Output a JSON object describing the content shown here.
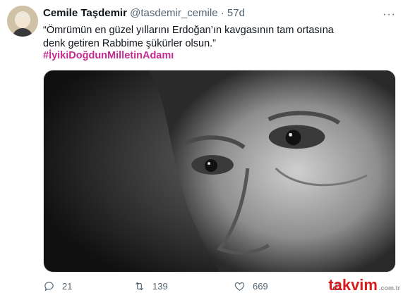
{
  "tweet": {
    "author_name": "Cemile Taşdemir",
    "handle": "@tasdemir_cemile",
    "separator": "·",
    "time": "57d",
    "text": "“Ömrümün en güzel yıllarını Erdoğan’ın kavgasının tam ortasına denk getiren Rabbime şükürler olsun.”",
    "hashtag": "#İyikiDoğdunMilletinAdamı",
    "more_label": "···",
    "media_icon": "portrait-photo"
  },
  "actions": {
    "reply_count": "21",
    "retweet_count": "139",
    "like_count": "669"
  },
  "watermark": {
    "brand": "takvim",
    "domain": ".com.tr"
  },
  "colors": {
    "hashtag": "#c42a8f",
    "muted": "#536471",
    "watermark": "#d91c1c"
  }
}
